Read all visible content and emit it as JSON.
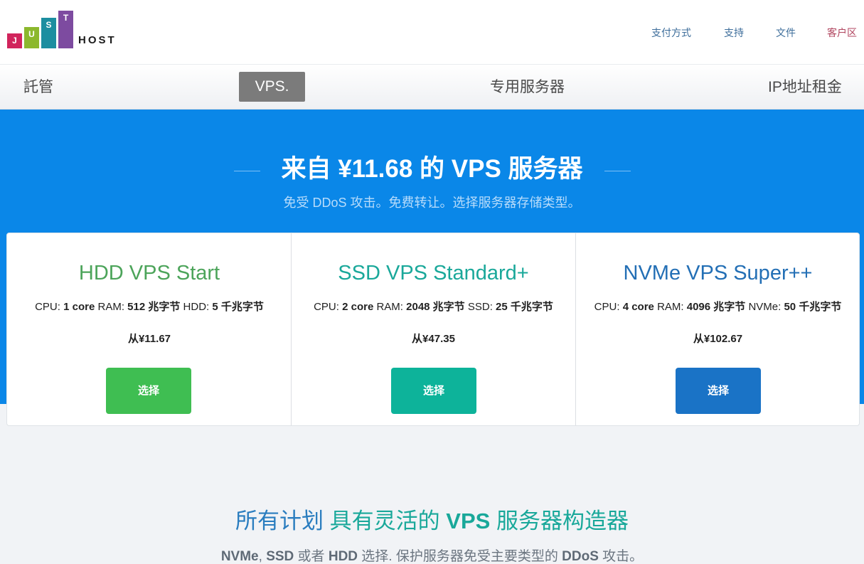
{
  "logo": {
    "letters": [
      "J",
      "U",
      "S",
      "T"
    ],
    "word": "HOST",
    "colors": [
      "#d1245c",
      "#8cb82d",
      "#1c8ea0",
      "#7d4ba0"
    ]
  },
  "toplinks": [
    {
      "label": "支付方式",
      "color": "#3e6e9b"
    },
    {
      "label": "支持",
      "color": "#3e6e9b"
    },
    {
      "label": "文件",
      "color": "#3e6e9b"
    },
    {
      "label": "客户区",
      "color": "#b0455f"
    }
  ],
  "nav": [
    "託管",
    "VPS.",
    "专用服务器",
    "IP地址租金"
  ],
  "hero": {
    "title": "来自 ¥11.68 的 VPS 服务器",
    "subtitle": "免受 DDoS 攻击。免费转让。选择服务器存储类型。",
    "background": "#0a87e8"
  },
  "plans": [
    {
      "title": "HDD VPS Start",
      "color": "#4ca45a",
      "cpu_label": "CPU:",
      "cpu": "1 core",
      "ram_label": "RAM:",
      "ram": "512 兆字节",
      "disk_label": "HDD:",
      "disk": "5 千兆字节",
      "price": "从¥11.67",
      "button": "选择",
      "button_color": "#3fbe52"
    },
    {
      "title": "SSD VPS Standard+",
      "color": "#1aa89a",
      "cpu_label": "CPU:",
      "cpu": "2 core",
      "ram_label": "RAM:",
      "ram": "2048 兆字节",
      "disk_label": "SSD:",
      "disk": "25 千兆字节",
      "price": "从¥47.35",
      "button": "选择",
      "button_color": "#0db39a"
    },
    {
      "title": "NVMe VPS Super++",
      "color": "#236fb5",
      "cpu_label": "CPU:",
      "cpu": "4 core",
      "ram_label": "RAM:",
      "ram": "4096 兆字节",
      "disk_label": "NVMe:",
      "disk": "50 千兆字节",
      "price": "从¥102.67",
      "button": "选择",
      "button_color": "#1a73c6"
    }
  ],
  "section": {
    "title_part1": "所有计划",
    "title_part2": "具有灵活的",
    "title_part3": "VPS",
    "title_part4": "服务器构造器",
    "sub_nvme": "NVMe",
    "sub_comma": ",",
    "sub_ssd": "SSD",
    "sub_or": "或者",
    "sub_hdd": "HDD",
    "sub_mid": "选择. 保护服务器免受主要类型的",
    "sub_ddos": "DDoS",
    "sub_end": "攻击。"
  }
}
